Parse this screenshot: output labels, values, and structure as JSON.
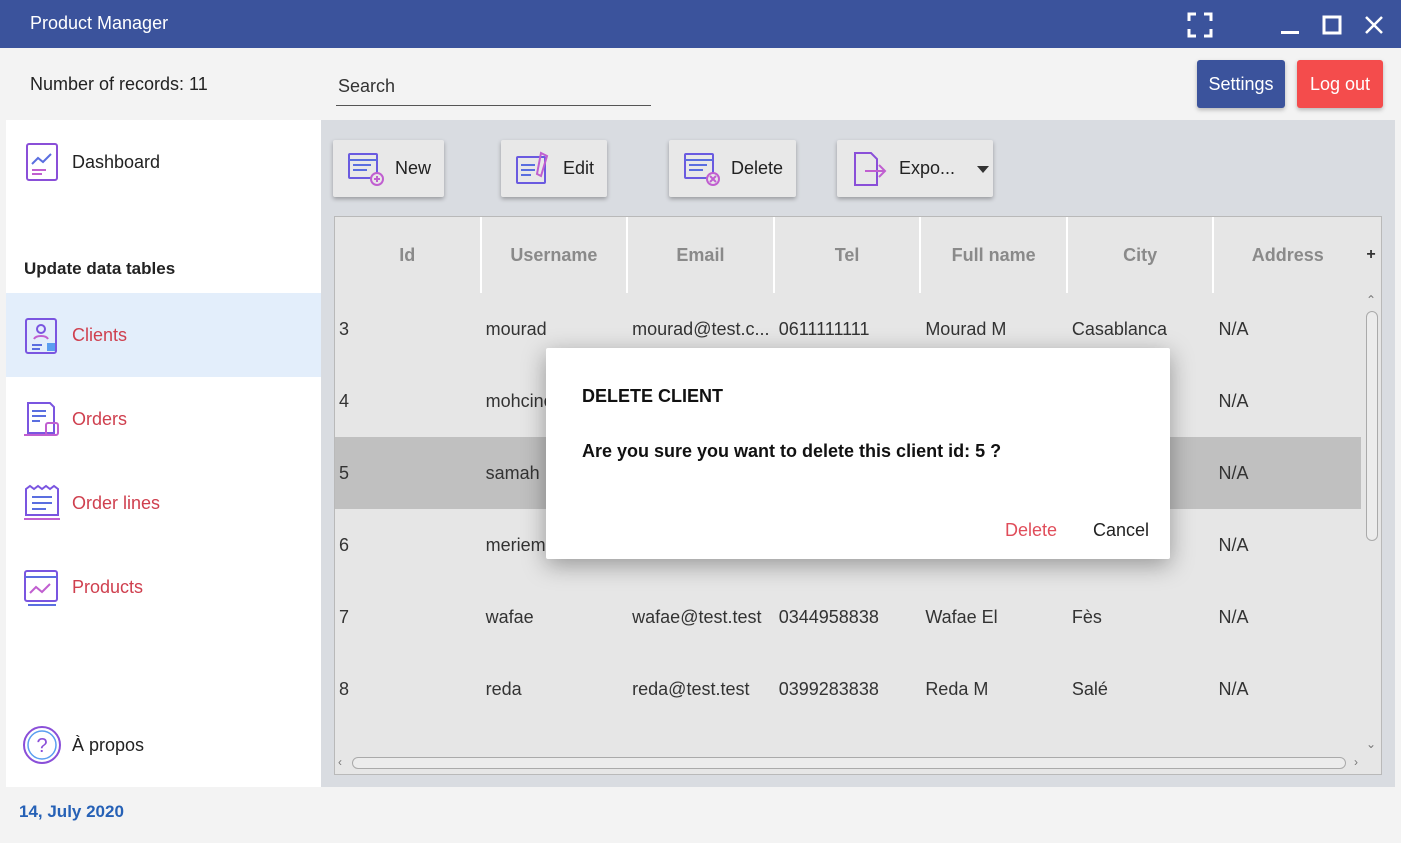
{
  "window": {
    "title": "Product Manager"
  },
  "header": {
    "records_label": "Number of records: 11",
    "search_placeholder": "Search",
    "settings_label": "Settings",
    "logout_label": "Log out"
  },
  "sidebar": {
    "dashboard_label": "Dashboard",
    "section_label": "Update data tables",
    "items": [
      {
        "label": "Clients",
        "icon": "clients-icon"
      },
      {
        "label": "Orders",
        "icon": "orders-icon"
      },
      {
        "label": "Order lines",
        "icon": "order-lines-icon"
      },
      {
        "label": "Products",
        "icon": "products-icon"
      }
    ],
    "about_label": "À propos",
    "active_item": "Clients"
  },
  "footer": {
    "date": "14, July 2020"
  },
  "toolbar": {
    "new_label": "New",
    "edit_label": "Edit",
    "delete_label": "Delete",
    "export_label": "Expo..."
  },
  "table": {
    "columns": [
      "Id",
      "Username",
      "Email",
      "Tel",
      "Full name",
      "City",
      "Address"
    ],
    "rows": [
      [
        "3",
        "mourad",
        "mourad@test.c...",
        "0611111111",
        "Mourad M",
        "Casablanca",
        "N/A"
      ],
      [
        "4",
        "mohcine",
        "",
        "",
        "",
        "",
        "N/A"
      ],
      [
        "5",
        "samah",
        "",
        "",
        "",
        "",
        "N/A"
      ],
      [
        "6",
        "meriem",
        "",
        "",
        "",
        "",
        "N/A"
      ],
      [
        "7",
        "wafae",
        "wafae@test.test",
        "0344958838",
        "Wafae El",
        "Fès",
        "N/A"
      ],
      [
        "8",
        "reda",
        "reda@test.test",
        "0399283838",
        "Reda M",
        "Salé",
        "N/A"
      ]
    ],
    "selected_row_id": "5"
  },
  "dialog": {
    "title": "DELETE CLIENT",
    "message": "Are you sure you want to delete this client id: 5 ?",
    "confirm_label": "Delete",
    "cancel_label": "Cancel"
  },
  "colors": {
    "titlebar": "#3b539c",
    "settings": "#3b539c",
    "logout": "#f44c4c",
    "accent_red": "#cf3f4e",
    "date_blue": "#2661b6",
    "selected_row": "#c0c0c0",
    "active_sidebar": "#e3eefb"
  }
}
